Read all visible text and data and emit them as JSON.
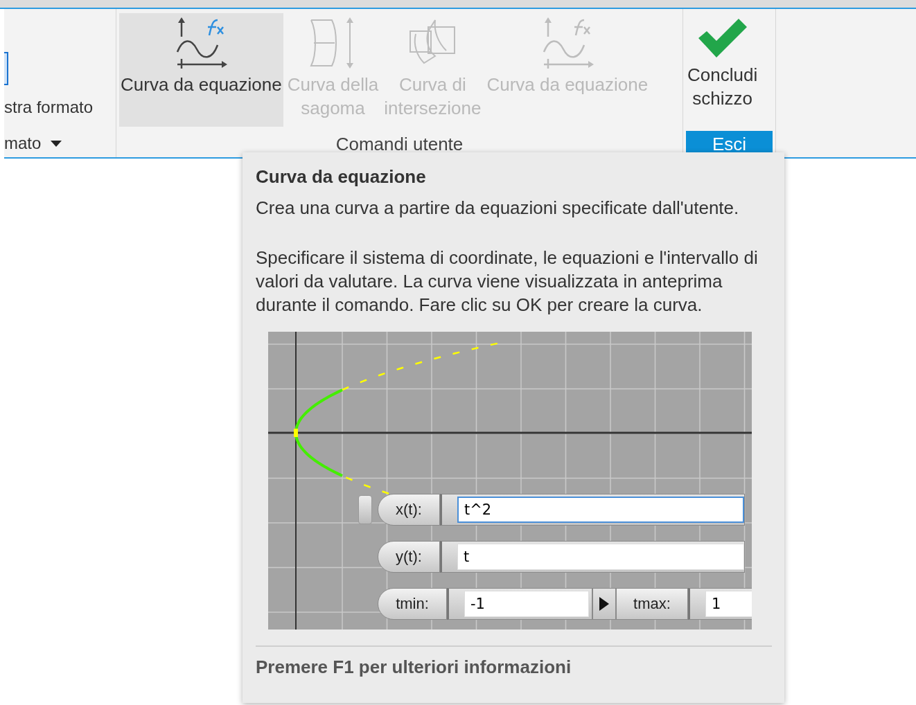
{
  "ribbon": {
    "left_group": {
      "button_label": "stra formato",
      "dropdown_label": "mato"
    },
    "groups": [
      {
        "label": "Comandi utente",
        "kind": "plain",
        "buttons": [
          {
            "label": "Curva da equazione",
            "kind": "equation",
            "selected": true,
            "disabled": false
          },
          {
            "label": "Curva della\nsagoma",
            "kind": "silhouette",
            "selected": false,
            "disabled": true
          },
          {
            "label": "Curva di\nintersezione",
            "kind": "intersection",
            "selected": false,
            "disabled": true
          },
          {
            "label": "Curva da equazione",
            "kind": "equation",
            "selected": false,
            "disabled": true
          }
        ]
      },
      {
        "label": "Esci",
        "kind": "highlighted",
        "buttons": [
          {
            "label": "Concludi\nschizzo",
            "kind": "check",
            "selected": false,
            "disabled": false
          }
        ]
      }
    ]
  },
  "tooltip": {
    "title": "Curva da equazione",
    "summary": "Crea una curva a partire da equazioni specificate dall'utente.",
    "description": "Specificare il sistema di coordinate, le equazioni e l'intervallo di valori da valutare. La curva viene visualizzata in anteprima durante il comando. Fare clic su OK per creare la curva.",
    "preview": {
      "fields": [
        {
          "label": "x(t):",
          "value": "t^2",
          "focused": true
        },
        {
          "label": "y(t):",
          "value": "t",
          "focused": false
        }
      ],
      "range": {
        "tmin_label": "tmin:",
        "tmin": "-1",
        "tmax_label": "tmax:",
        "tmax": "1"
      }
    },
    "footer": "Premere F1 per ulteriori informazioni"
  }
}
